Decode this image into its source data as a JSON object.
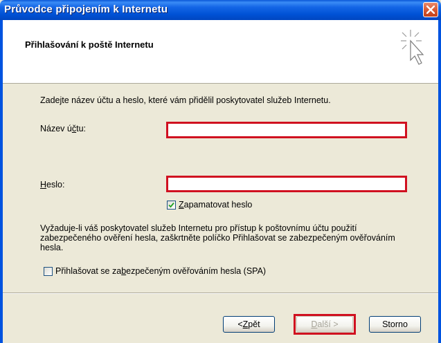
{
  "window": {
    "title": "Průvodce připojením k Internetu",
    "close_icon": "close-icon"
  },
  "header": {
    "heading": "Přihlašování k poště Internetu",
    "icon": "wizard-cursor-icon"
  },
  "form": {
    "intro": "Zadejte název účtu a heslo, které vám přidělil poskytovatel služeb Internetu.",
    "account_label": "Název účtu:",
    "account_value": "",
    "password_label": "Heslo:",
    "password_value": "",
    "remember_label": "Zapamatovat heslo",
    "remember_checked": true,
    "spa_paragraph": "Vyžaduje-li váš poskytovatel služeb Internetu pro přístup k poštovnímu účtu použití zabezpečeného ověření hesla, zaškrtněte políčko Přihlašovat se zabezpečeným ověřováním hesla.",
    "spa_label": "Přihlašovat se zabezpečeným ověřováním hesla (SPA)",
    "spa_checked": false
  },
  "buttons": {
    "back": "< Zpět",
    "next": "Další >",
    "cancel": "Storno"
  },
  "colors": {
    "highlight": "#d01020",
    "titlebar": "#0052d6",
    "face": "#ece9d8"
  }
}
